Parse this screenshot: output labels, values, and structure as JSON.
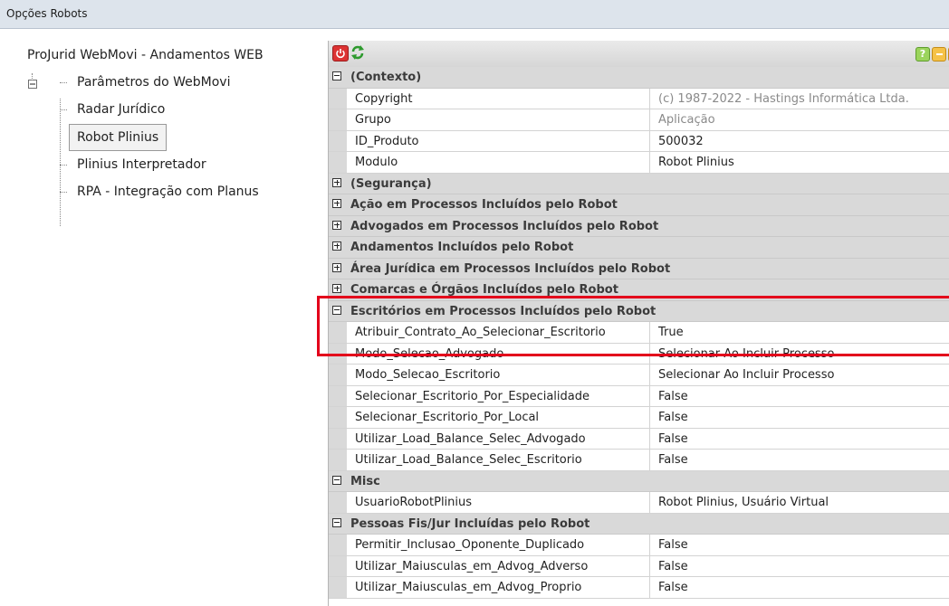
{
  "window": {
    "title": "Opções Robots"
  },
  "tree": {
    "root": "ProJurid WebMovi - Andamentos WEB",
    "items": [
      {
        "label": "Parâmetros do WebMovi"
      },
      {
        "label": "Radar Jurídico"
      },
      {
        "label": "Robot Plinius",
        "selected": true
      },
      {
        "label": "Plinius Interpretador"
      },
      {
        "label": "RPA - Integração com Planus"
      }
    ]
  },
  "toolbar": {
    "power_icon": "power-icon",
    "refresh_icon": "refresh-icon",
    "help_label": "?",
    "expand_label": "+"
  },
  "grid": {
    "c1": {
      "title": "(Contexto)"
    },
    "c1_rows": [
      {
        "name": "Copyright",
        "value": "(c) 1987-2022 - Hastings Informática Ltda."
      },
      {
        "name": "Grupo",
        "value": "Aplicação"
      },
      {
        "name": "ID_Produto",
        "value": "500032"
      },
      {
        "name": "Modulo",
        "value": "Robot Plinius"
      }
    ],
    "c2": {
      "title": "(Segurança)"
    },
    "c3": {
      "title": "Ação em Processos Incluídos pelo Robot"
    },
    "c4": {
      "title": "Advogados em Processos Incluídos pelo Robot"
    },
    "c5": {
      "title": "Andamentos Incluídos pelo Robot"
    },
    "c6": {
      "title": "Área Jurídica em Processos Incluídos pelo Robot"
    },
    "c7": {
      "title": "Comarcas e Órgãos Incluídos pelo Robot"
    },
    "c8": {
      "title": "Escritórios em Processos Incluídos pelo Robot"
    },
    "c8_rows": [
      {
        "name": "Atribuir_Contrato_Ao_Selecionar_Escritorio",
        "value": "True"
      },
      {
        "name": "Modo_Selecao_Advogado",
        "value": "Selecionar Ao Incluir Processo"
      },
      {
        "name": "Modo_Selecao_Escritorio",
        "value": "Selecionar Ao Incluir Processo"
      },
      {
        "name": "Selecionar_Escritorio_Por_Especialidade",
        "value": "False"
      },
      {
        "name": "Selecionar_Escritorio_Por_Local",
        "value": "False"
      },
      {
        "name": "Utilizar_Load_Balance_Selec_Advogado",
        "value": "False"
      },
      {
        "name": "Utilizar_Load_Balance_Selec_Escritorio",
        "value": "False"
      }
    ],
    "c9": {
      "title": "Misc"
    },
    "c9_rows": [
      {
        "name": "UsuarioRobotPlinius",
        "value": "Robot Plinius, Usuário Virtual"
      }
    ],
    "c10": {
      "title": "Pessoas Fis/Jur Incluídas pelo Robot"
    },
    "c10_rows": [
      {
        "name": "Permitir_Inclusao_Oponente_Duplicado",
        "value": "False"
      },
      {
        "name": "Utilizar_Maiusculas_em_Advog_Adverso",
        "value": "False"
      },
      {
        "name": "Utilizar_Maiusculas_em_Advog_Proprio",
        "value": "False"
      }
    ]
  },
  "annotation": {
    "highlight_color": "#e3001b"
  }
}
